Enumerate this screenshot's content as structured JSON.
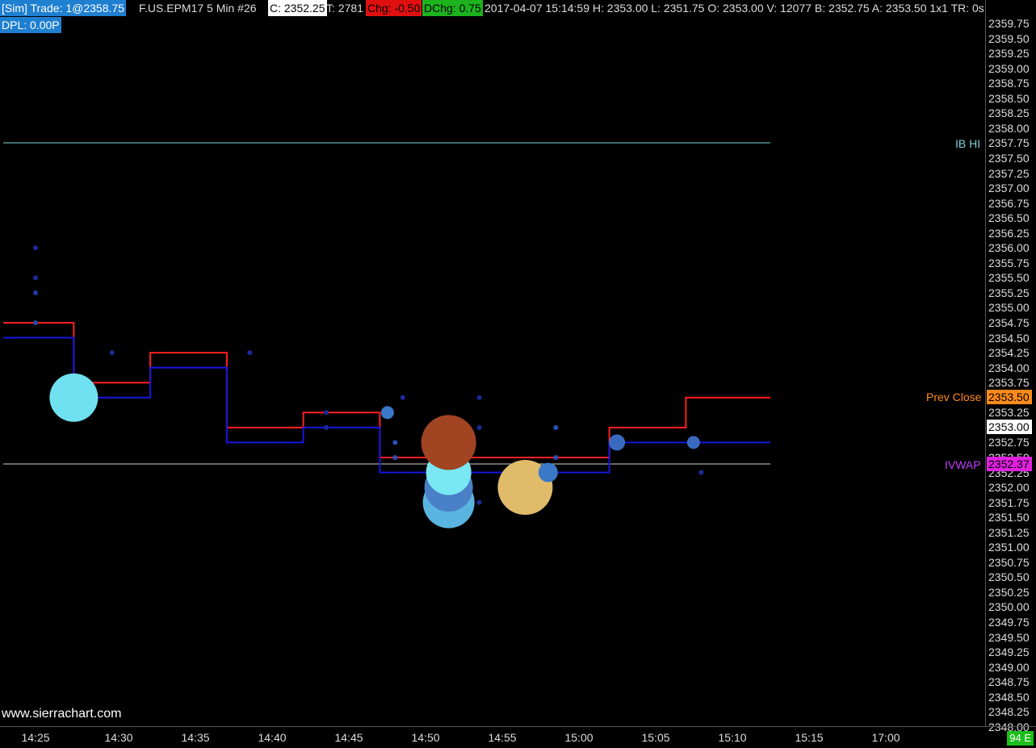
{
  "toolbar": {
    "sim_trade": "[Sim]  Trade: 1@2358.75",
    "symbol_info": "F.US.EPM17  5 Min   #26",
    "close": "C: 2352.25",
    "ticks": "T: 2781",
    "change": "Chg: -0.50",
    "daily_change": "DChg: 0.75",
    "bar_info": "2017-04-07 15:14:59 H: 2353.00 L: 2351.75 O: 2353.00 V: 12077 B: 2352.75 A: 2353.50 1x1 TR: 0s",
    "dpl": "DPL: 0.00P"
  },
  "colors": {
    "sim_bg": "#1f7fd0",
    "close_bg": "#ffffff",
    "change_bg": "#e01010",
    "daily_change_bg": "#1db31d",
    "upper_line": "#ff2020",
    "lower_line": "#1515e0",
    "ib_hi": "#7fd6d6",
    "prev_close": "#ff8a1a",
    "vwap_box": "#e020e0",
    "vwap_text": "#c040ff"
  },
  "price_axis": {
    "labels": [
      "2359.75",
      "2359.50",
      "2359.25",
      "2359.00",
      "2358.75",
      "2358.50",
      "2358.25",
      "2358.00",
      "2357.75",
      "2357.50",
      "2357.25",
      "2357.00",
      "2356.75",
      "2356.50",
      "2356.25",
      "2356.00",
      "2355.75",
      "2355.50",
      "2355.25",
      "2355.00",
      "2354.75",
      "2354.50",
      "2354.25",
      "2354.00",
      "2353.75",
      "2353.50",
      "2353.25",
      "2353.00",
      "2352.75",
      "2352.50",
      "2352.25",
      "2352.00",
      "2351.75",
      "2351.50",
      "2351.25",
      "2351.00",
      "2350.75",
      "2350.50",
      "2350.25",
      "2350.00",
      "2349.75",
      "2349.50",
      "2349.25",
      "2349.00",
      "2348.75",
      "2348.50",
      "2348.25",
      "2348.00"
    ]
  },
  "time_axis": {
    "labels": [
      "14:25",
      "14:30",
      "14:35",
      "14:40",
      "14:45",
      "14:50",
      "14:55",
      "15:00",
      "15:05",
      "15:10",
      "15:15",
      "17:00"
    ]
  },
  "reference_lines": {
    "ib_hi": {
      "label": "IB HI",
      "price": 2357.75
    },
    "prev_close": {
      "label": "Prev Close",
      "price": 2353.5,
      "box": "2353.50"
    },
    "current_price": {
      "box": "2353.00",
      "price": 2353.0
    },
    "vwap": {
      "label": "VWAP",
      "price": 2352.37,
      "box": "2352.37"
    }
  },
  "watermark": "www.sierrachart.com",
  "status": "94 E",
  "chart_data": {
    "type": "line",
    "series": [
      {
        "name": "",
        "steps": [
          {
            "t": "14:22.5",
            "v": 2354.75
          },
          {
            "t": "14:27.5",
            "v": 2353.75
          },
          {
            "t": "14:32.5",
            "v": 2354.25
          },
          {
            "t": "14:37.5",
            "v": 2353.0
          },
          {
            "t": "14:42.5",
            "v": 2353.25
          },
          {
            "t": "14:47.5",
            "v": 2352.5
          },
          {
            "t": "14:52.5",
            "v": 2352.5
          },
          {
            "t": "14:57.5",
            "v": 2352.5
          },
          {
            "t": "15:02.5",
            "v": 2353.0
          },
          {
            "t": "15:07.5",
            "v": 2353.5
          }
        ]
      },
      {
        "name": "",
        "steps": [
          {
            "t": "14:22.5",
            "v": 2354.5
          },
          {
            "t": "14:27.5",
            "v": 2353.5
          },
          {
            "t": "14:32.5",
            "v": 2354.0
          },
          {
            "t": "14:37.5",
            "v": 2352.75
          },
          {
            "t": "14:42.5",
            "v": 2353.0
          },
          {
            "t": "14:47.5",
            "v": 2352.25
          },
          {
            "t": "14:52.5",
            "v": 2352.25
          },
          {
            "t": "14:57.5",
            "v": 2352.25
          },
          {
            "t": "15:02.5",
            "v": 2352.75
          },
          {
            "t": "15:07.5",
            "v": 2352.75
          }
        ]
      }
    ],
    "bubbles": [
      {
        "t": "14:25",
        "v": 2356.0,
        "size": 1,
        "color": "#1a2a9a"
      },
      {
        "t": "14:25",
        "v": 2355.5,
        "size": 1,
        "color": "#1a2a9a"
      },
      {
        "t": "14:25",
        "v": 2355.25,
        "size": 2,
        "color": "#1e3aa8"
      },
      {
        "t": "14:25",
        "v": 2354.75,
        "size": 2,
        "color": "#2a4aa8"
      },
      {
        "t": "14:27.5",
        "v": 2353.5,
        "size": 30,
        "color": "#6fe0f0"
      },
      {
        "t": "14:30",
        "v": 2354.25,
        "size": 1,
        "color": "#1a2a9a"
      },
      {
        "t": "14:39",
        "v": 2354.25,
        "size": 1,
        "color": "#1a2a9a"
      },
      {
        "t": "14:44",
        "v": 2353.25,
        "size": 1,
        "color": "#1a2a9a"
      },
      {
        "t": "14:44",
        "v": 2353.0,
        "size": 1,
        "color": "#1a2a9a"
      },
      {
        "t": "14:48",
        "v": 2353.25,
        "size": 8,
        "color": "#3a78c8"
      },
      {
        "t": "14:48.5",
        "v": 2352.75,
        "size": 3,
        "color": "#2a50b8"
      },
      {
        "t": "14:48.5",
        "v": 2352.5,
        "size": 3,
        "color": "#2a50b8"
      },
      {
        "t": "14:49",
        "v": 2353.5,
        "size": 1,
        "color": "#1a2a9a"
      },
      {
        "t": "14:52",
        "v": 2351.75,
        "size": 32,
        "color": "#5ab4e0"
      },
      {
        "t": "14:52",
        "v": 2352.0,
        "size": 30,
        "color": "#4a80c8"
      },
      {
        "t": "14:52",
        "v": 2352.25,
        "size": 28,
        "color": "#7ae8f4"
      },
      {
        "t": "14:52",
        "v": 2352.75,
        "size": 34,
        "color": "#a04422"
      },
      {
        "t": "14:54",
        "v": 2353.5,
        "size": 1,
        "color": "#1a2a9a"
      },
      {
        "t": "14:54",
        "v": 2353.0,
        "size": 1,
        "color": "#1a2a9a"
      },
      {
        "t": "14:54",
        "v": 2351.75,
        "size": 1,
        "color": "#1a2a9a"
      },
      {
        "t": "14:57",
        "v": 2352.0,
        "size": 34,
        "color": "#e0bc6a"
      },
      {
        "t": "14:58.5",
        "v": 2352.25,
        "size": 12,
        "color": "#3a78c8"
      },
      {
        "t": "14:59",
        "v": 2352.5,
        "size": 3,
        "color": "#2a50b8"
      },
      {
        "t": "14:59",
        "v": 2353.0,
        "size": 3,
        "color": "#2a50b8"
      },
      {
        "t": "15:03",
        "v": 2352.75,
        "size": 10,
        "color": "#3a6ac0"
      },
      {
        "t": "15:08",
        "v": 2352.75,
        "size": 8,
        "color": "#3a6ac0"
      },
      {
        "t": "15:08.5",
        "v": 2352.25,
        "size": 1,
        "color": "#1a2a9a"
      }
    ]
  }
}
